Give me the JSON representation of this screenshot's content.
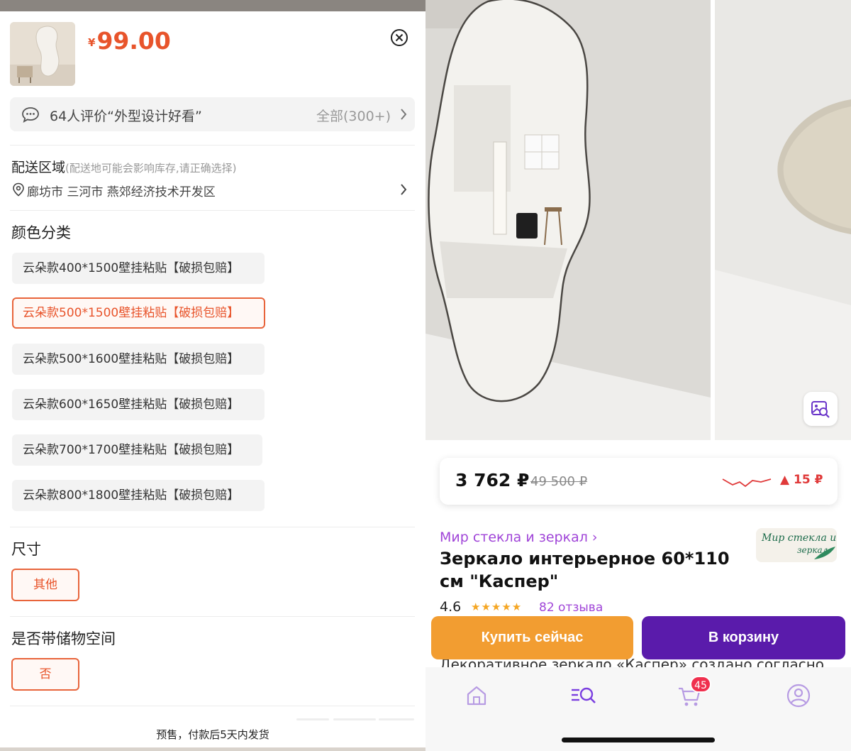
{
  "left": {
    "price_currency": "¥",
    "price": "99.00",
    "review_summary": "64人评价“外型设计好看”",
    "review_all": "全部(300+)",
    "shipping_title": "配送区域",
    "shipping_note": "(配送地可能会影响库存,请正确选择)",
    "shipping_address": "廊坊市 三河市 燕郊经济技术开发区",
    "color_title": "颜色分类",
    "color_options": [
      "云朵款400*1500壁挂粘贴【破损包赔】",
      "云朵款500*1500壁挂粘贴【破损包赔】",
      "云朵款500*1600壁挂粘贴【破损包赔】",
      "云朵款600*1650壁挂粘贴【破损包赔】",
      "云朵款700*1700壁挂粘贴【破损包赔】",
      "云朵款800*1800壁挂粘贴【破损包赔】"
    ],
    "selected_color_index": 1,
    "size_title": "尺寸",
    "size_value": "其他",
    "storage_title": "是否带储物空间",
    "storage_value": "否",
    "presale_note": "预售，付款后5天内发货",
    "accent_color": "#e8542b"
  },
  "right": {
    "current_price": "3 762 ₽",
    "old_price": "49 500 ₽",
    "price_delta": "▲ 15 ₽",
    "seller_name": "Мир стекла и зеркал ›",
    "seller_logo_line1": "Мир стекла и",
    "seller_logo_line2": "зеркал",
    "product_title": "Зеркало интерьерное 60*110 см \"Каспер\"",
    "rating": "4.6",
    "stars": "★★★★★",
    "reviews": "82 отзыва",
    "buy_now": "Купить сейчас",
    "add_to_cart": "В корзину",
    "description_preview": "Декоративное зеркало «Каспер» создано согласно",
    "cart_badge": "45",
    "tabs": [
      "home-icon",
      "catalog-search-icon",
      "cart-icon",
      "profile-icon"
    ],
    "brand_color": "#5a1bab",
    "buy_color": "#f29d31"
  }
}
